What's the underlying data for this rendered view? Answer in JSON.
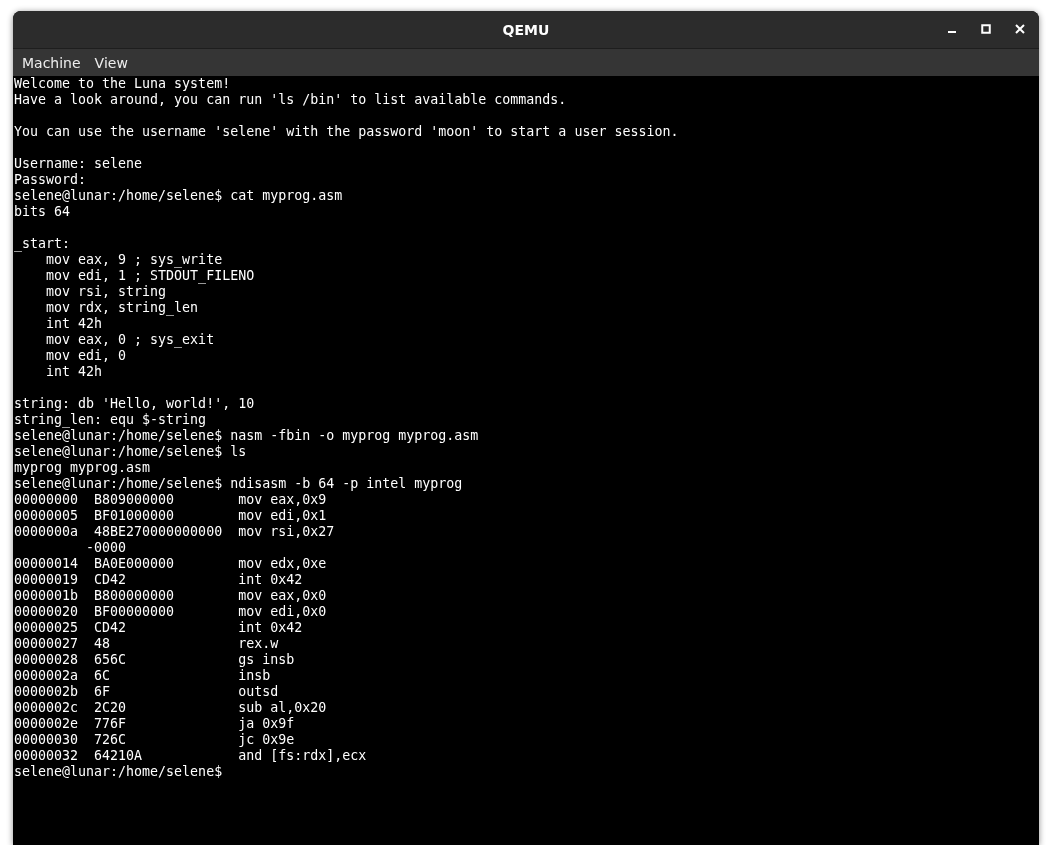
{
  "window": {
    "title": "QEMU"
  },
  "menu": [
    "Machine",
    "View"
  ],
  "terminal": {
    "blocks": [
      [
        "Welcome to the Luna system!",
        "Have a look around, you can run 'ls /bin' to list available commands."
      ],
      [
        "You can use the username 'selene' with the password 'moon' to start a user session."
      ],
      [
        "Username: selene",
        "Password:",
        "selene@lunar:/home/selene$ cat myprog.asm",
        "bits 64"
      ],
      [
        "_start:",
        "    mov eax, 9 ; sys_write",
        "    mov edi, 1 ; STDOUT_FILENO",
        "    mov rsi, string",
        "    mov rdx, string_len",
        "    int 42h",
        "    mov eax, 0 ; sys_exit",
        "    mov edi, 0",
        "    int 42h"
      ],
      [
        "string: db 'Hello, world!', 10",
        "string_len: equ $-string",
        "selene@lunar:/home/selene$ nasm -fbin -o myprog myprog.asm",
        "selene@lunar:/home/selene$ ls",
        "myprog myprog.asm",
        "selene@lunar:/home/selene$ ndisasm -b 64 -p intel myprog",
        "00000000  B809000000        mov eax,0x9",
        "00000005  BF01000000        mov edi,0x1",
        "0000000a  48BE270000000000  mov rsi,0x27",
        "         -0000",
        "00000014  BA0E000000        mov edx,0xe",
        "00000019  CD42              int 0x42",
        "0000001b  B800000000        mov eax,0x0",
        "00000020  BF00000000        mov edi,0x0",
        "00000025  CD42              int 0x42",
        "00000027  48                rex.w",
        "00000028  656C              gs insb",
        "0000002a  6C                insb",
        "0000002b  6F                outsd",
        "0000002c  2C20              sub al,0x20",
        "0000002e  776F              ja 0x9f",
        "00000030  726C              jc 0x9e",
        "00000032  64210A            and [fs:rdx],ecx",
        "selene@lunar:/home/selene$"
      ]
    ]
  }
}
